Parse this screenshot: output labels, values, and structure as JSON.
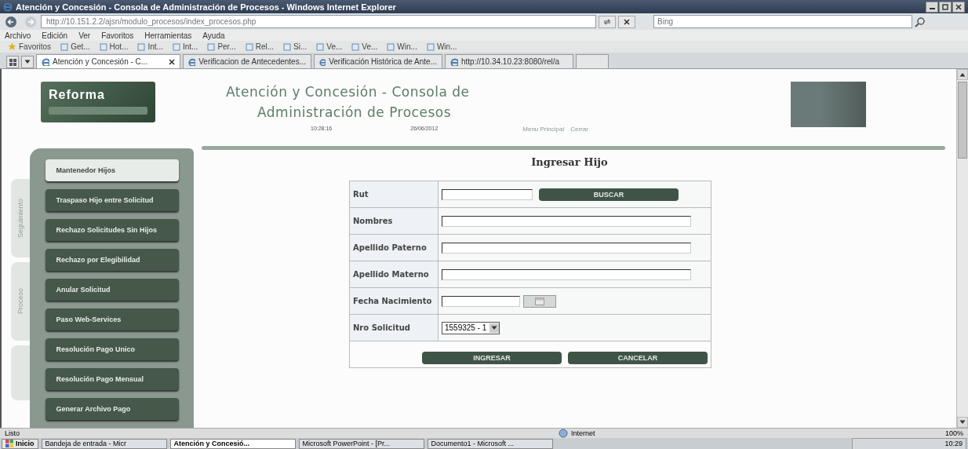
{
  "window": {
    "title": "Atención y Concesión - Consola de Administración de Procesos - Windows Internet Explorer"
  },
  "address_bar": {
    "url": "http://10.151.2.2/ajsn/modulo_procesos/index_procesos.php",
    "search_placeholder": "Bing"
  },
  "menu": [
    "Archivo",
    "Edición",
    "Ver",
    "Favoritos",
    "Herramientas",
    "Ayuda"
  ],
  "favorites_bar": {
    "label": "Favoritos",
    "items": [
      "Get...",
      "Hot...",
      "Int...",
      "Int...",
      "Per...",
      "Rel...",
      "Si...",
      "Ve...",
      "Ve...",
      "Win...",
      "Win..."
    ]
  },
  "browser_tabs": [
    {
      "label": "Atención y Concesión - C...",
      "selected": true
    },
    {
      "label": "Verificacion de Antecedentes...",
      "selected": false
    },
    {
      "label": "Verificación Histórica de Ante...",
      "selected": false
    },
    {
      "label": "http://10.34.10.23:8080/rel/a",
      "selected": false
    }
  ],
  "page": {
    "logo": {
      "title": "Reforma"
    },
    "header": {
      "title_lines": [
        "Atención y Concesión - Consola de",
        "Administración de Procesos"
      ],
      "time": "10:28:16",
      "date": "26/06/2012",
      "links": [
        "Menu Principal",
        "Cerrar"
      ]
    },
    "side_tabs": [
      "Seguimiento",
      "Proceso"
    ],
    "sidebar": [
      {
        "label": "Mantenedor Hijos",
        "selected": true
      },
      {
        "label": "Traspaso Hijo entre Solicitud",
        "selected": false
      },
      {
        "label": "Rechazo Solicitudes Sin Hijos",
        "selected": false
      },
      {
        "label": "Rechazo por Elegibilidad",
        "selected": false
      },
      {
        "label": "Anular Solicitud",
        "selected": false
      },
      {
        "label": "Paso Web-Services",
        "selected": false
      },
      {
        "label": "Resolución Pago Unico",
        "selected": false
      },
      {
        "label": "Resolución Pago Mensual",
        "selected": false
      },
      {
        "label": "Generar Archivo Pago",
        "selected": false
      }
    ],
    "form": {
      "title": "Ingresar Hijo",
      "rows": [
        {
          "label": "Rut",
          "kind": "search",
          "button": "BUSCAR"
        },
        {
          "label": "Nombres",
          "kind": "text"
        },
        {
          "label": "Apellido Paterno",
          "kind": "text"
        },
        {
          "label": "Apellido Materno",
          "kind": "text"
        },
        {
          "label": "Fecha Nacimiento",
          "kind": "date"
        },
        {
          "label": "Nro Solicitud",
          "kind": "select",
          "value": "1559325 - 1"
        }
      ],
      "buttons": [
        "INGRESAR",
        "CANCELAR"
      ]
    }
  },
  "status_bar": {
    "text": "Listo",
    "zone": "Internet",
    "zoom": "100%"
  },
  "taskbar": {
    "start": "Inicio",
    "items": [
      {
        "label": "Bandeja de entrada - Micr",
        "selected": false
      },
      {
        "label": "Atención y Concesió...",
        "selected": true
      },
      {
        "label": "Microsoft PowerPoint - [Pr...",
        "selected": false
      },
      {
        "label": "Documento1 - Microsoft ...",
        "selected": false
      }
    ],
    "clock": "10:29"
  }
}
